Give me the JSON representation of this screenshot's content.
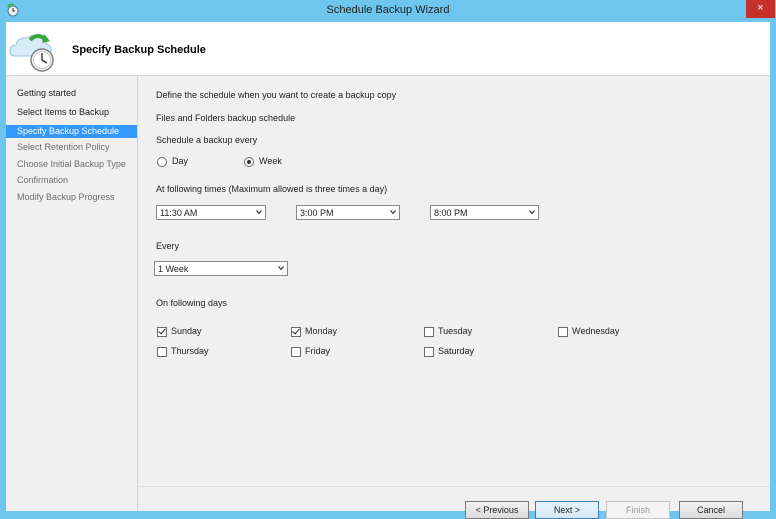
{
  "window": {
    "title": "Schedule Backup Wizard",
    "close_label": "×",
    "colors": {
      "frame": "#6ec6ee",
      "close": "#c7302a",
      "nav_active": "#3399ff"
    }
  },
  "header": {
    "title": "Specify Backup Schedule",
    "icon": "cloud-clock-icon"
  },
  "nav": {
    "items": [
      {
        "label": "Getting started",
        "state": "done"
      },
      {
        "label": "Select Items to Backup",
        "state": "done"
      },
      {
        "label": "Specify Backup Schedule",
        "state": "active"
      },
      {
        "label": "Select Retention Policy",
        "state": "pending"
      },
      {
        "label": "Choose Initial Backup Type",
        "state": "pending"
      },
      {
        "label": "Confirmation",
        "state": "pending"
      },
      {
        "label": "Modify Backup Progress",
        "state": "pending"
      }
    ]
  },
  "main": {
    "intro": "Define the schedule when you want to create a backup copy",
    "section_title": "Files and Folders backup schedule",
    "frequency": {
      "label": "Schedule a backup every",
      "options": [
        {
          "label": "Day",
          "selected": false
        },
        {
          "label": "Week",
          "selected": true
        }
      ]
    },
    "times": {
      "label": "At following times (Maximum allowed is three times a day)",
      "values": [
        "11:30 AM",
        "3:00 PM",
        "8:00 PM"
      ]
    },
    "every": {
      "label": "Every",
      "value": "1 Week"
    },
    "days": {
      "label": "On following days",
      "items": [
        {
          "label": "Sunday",
          "checked": true
        },
        {
          "label": "Monday",
          "checked": true
        },
        {
          "label": "Tuesday",
          "checked": false
        },
        {
          "label": "Wednesday",
          "checked": false
        },
        {
          "label": "Thursday",
          "checked": false
        },
        {
          "label": "Friday",
          "checked": false
        },
        {
          "label": "Saturday",
          "checked": false
        }
      ]
    }
  },
  "footer": {
    "previous": "< Previous",
    "next": "Next >",
    "finish": "Finish",
    "cancel": "Cancel"
  }
}
